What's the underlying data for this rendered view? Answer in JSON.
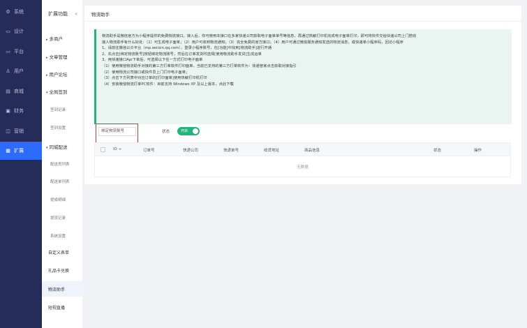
{
  "sidebar": {
    "items": [
      {
        "label": "系统",
        "icon": "gear-icon"
      },
      {
        "label": "设计",
        "icon": "monitor-icon"
      },
      {
        "label": "平台",
        "icon": "monitor-icon"
      },
      {
        "label": "用户",
        "icon": "user-icon"
      },
      {
        "label": "商城",
        "icon": "shop-icon"
      },
      {
        "label": "财务",
        "icon": "finance-icon"
      },
      {
        "label": "营销",
        "icon": "marketing-icon"
      },
      {
        "label": "扩展",
        "icon": "grid-icon",
        "active": true
      }
    ]
  },
  "submenu": {
    "title": "扩展功能",
    "collapse_icon": "«",
    "groups": [
      {
        "label": "多商户",
        "expanded": false
      },
      {
        "label": "文章管理",
        "expanded": false
      },
      {
        "label": "用户论坛",
        "expanded": false
      },
      {
        "label": "全局签到",
        "expanded": true,
        "children": [
          "签到记录",
          "签到设置"
        ]
      },
      {
        "label": "同城配送",
        "expanded": true,
        "children": [
          "配送员列表",
          "配送单列表",
          "提成明细",
          "提现记录",
          "系统设置"
        ]
      }
    ],
    "extra_items": [
      "自定义表单",
      "礼品卡兑换",
      "物流助手",
      "短视直播"
    ],
    "active_item": "物流助手"
  },
  "main": {
    "title": "物流助手",
    "notice": [
      "物流助手是微信官方为小程序提供的免费物流接口。接入后，你可使用本接口在多家快递公司获取电子面单单号等信息，再通过热敏打印机完成电子面单打印，即可将快件交给快递公司上门揽收",
      "接入物流助手有什么好处：（1）可生成电子面单；（2）用户可收到物流通知；（3）完全免费的官方接口；（4）用户可通过微信服务通知发送的物流消息，或快递单小程序码，回访小程序",
      "1、请前往微信公众平台（mp.weixin.qq.com），登录小程序账号，在[功能]中找到[物流助手]进行开通",
      "2、先点击[绑定物流账号]按钮绑定物流账号，然后在订单发货时选择[使用物流助手发货]生成运单",
      "3、用快递接口Api下单后，可选择以下任一方式打印电子面单",
      "（1）使用微信物流助手对接的第三方打单软件打印面单，当前已支持的第三方打单软件为：快递管家点击获取对接指引",
      "（2）使用物流公司接口或快件员上门打印电子面单；",
      "（3）点击下方列表中对应订单的[打印面单]使用热敏打印机打印",
      "（4）安装微信物流打单PC软件：目前支持 Windows XP 及以上版本，点此下载"
    ],
    "bind_button": "绑定物流账号",
    "status_label": "状态",
    "toggle_text": "开启",
    "toggle_on": true,
    "table": {
      "columns": [
        "ID ÷",
        "订单号",
        "快递公司",
        "快递单号",
        "收货地址",
        "商品信息",
        "状态",
        "操作"
      ],
      "empty_text": "无数据"
    }
  },
  "colors": {
    "sidebar": "#262c5a",
    "accent": "#2d6bff",
    "green": "#23b37b",
    "highlight": "#e03030"
  }
}
